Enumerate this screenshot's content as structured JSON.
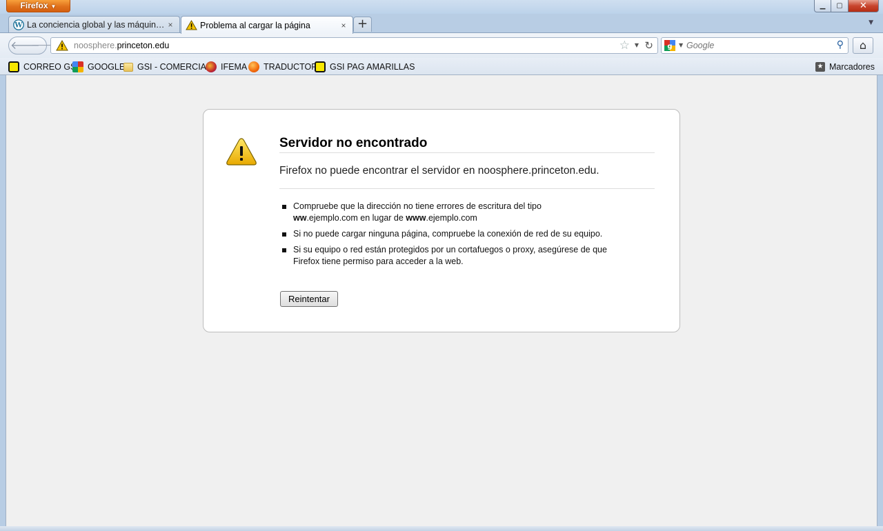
{
  "window": {
    "app_button_label": "Firefox",
    "controls": {
      "minimize": "▁",
      "maximize": "▢",
      "close": "✕"
    }
  },
  "tabs": [
    {
      "title": "La conciencia global y las máquinas ...",
      "icon": "wordpress-icon",
      "close": "×",
      "active": false
    },
    {
      "title": "Problema al cargar la página",
      "icon": "warning-icon",
      "close": "×",
      "active": true
    }
  ],
  "new_tab_label": "+",
  "navigation": {
    "url_subdomain": "noosphere.",
    "url_domain": "princeton.edu",
    "search_placeholder": "Google"
  },
  "bookmarks": [
    {
      "label": "CORREO GSI",
      "icon": "yellow-square-icon"
    },
    {
      "label": "GOOGLE",
      "icon": "google-icon"
    },
    {
      "label": "GSI - COMERCIAL",
      "icon": "folder-icon"
    },
    {
      "label": "IFEMA",
      "icon": "ifema-icon"
    },
    {
      "label": "TRADUCTOR",
      "icon": "orange-icon"
    },
    {
      "label": "GSI PAG AMARILLAS",
      "icon": "yellow-square-icon"
    }
  ],
  "bookmarks_menu_label": "Marcadores",
  "error": {
    "title": "Servidor no encontrado",
    "description": "Firefox no puede encontrar el servidor en noosphere.princeton.edu.",
    "tips": {
      "tip1_a": "Compruebe que la dirección no tiene errores de escritura del tipo",
      "tip1_b1": "ww",
      "tip1_b2": ".ejemplo.com en lugar de ",
      "tip1_b3": "www",
      "tip1_b4": ".ejemplo.com",
      "tip2": "Si no puede cargar ninguna página, compruebe la conexión de red de su equipo.",
      "tip3": "Si su equipo o red están protegidos por un cortafuegos o proxy, asegúrese de que Firefox tiene permiso para acceder a la web."
    },
    "retry_label": "Reintentar"
  },
  "colors": {
    "firefox_button": "#e0711b",
    "warning_yellow": "#f5c400",
    "page_background": "#f0f0f0"
  }
}
